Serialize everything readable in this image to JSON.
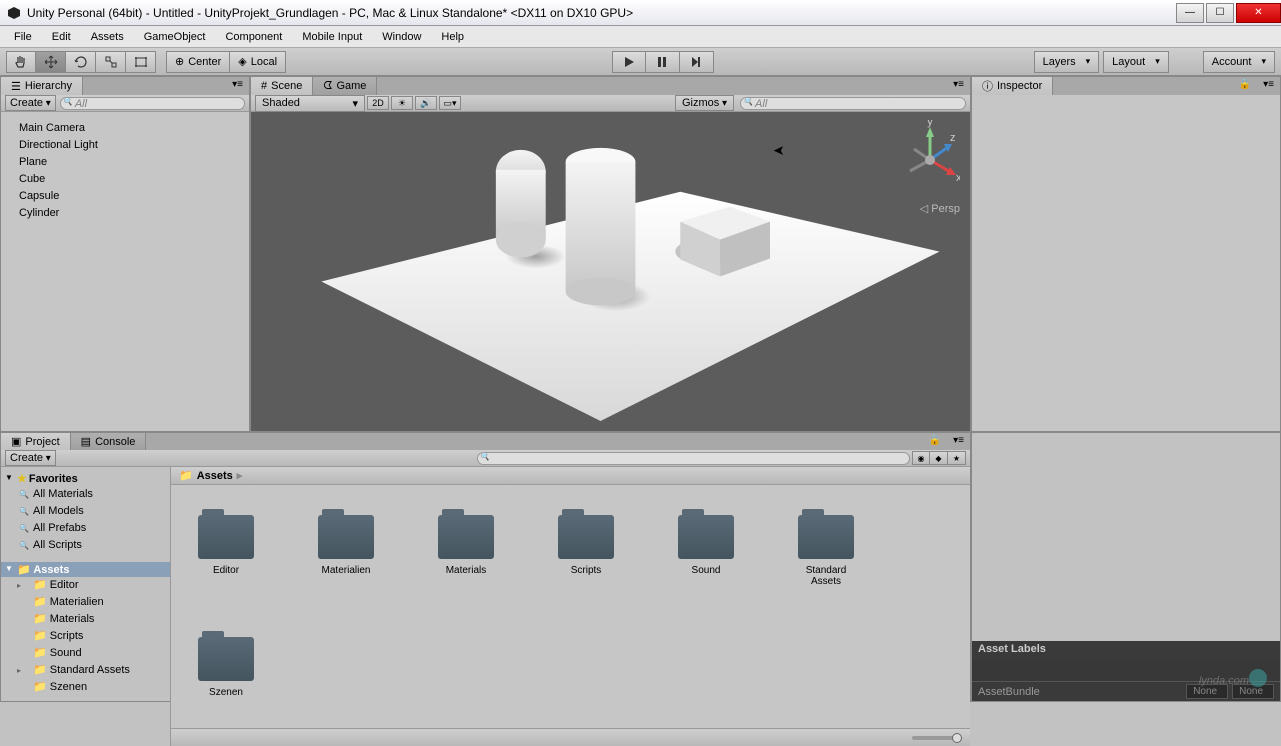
{
  "title": "Unity Personal (64bit) - Untitled - UnityProjekt_Grundlagen - PC, Mac & Linux Standalone* <DX11 on DX10 GPU>",
  "menu": [
    "File",
    "Edit",
    "Assets",
    "GameObject",
    "Component",
    "Mobile Input",
    "Window",
    "Help"
  ],
  "toolbar": {
    "center": "Center",
    "local": "Local",
    "layers": "Layers",
    "layout": "Layout",
    "account": "Account"
  },
  "hierarchy": {
    "tab": "Hierarchy",
    "create": "Create",
    "searchPlaceholder": "All",
    "items": [
      "Main Camera",
      "Directional Light",
      "Plane",
      "Cube",
      "Capsule",
      "Cylinder"
    ]
  },
  "scene": {
    "tabScene": "Scene",
    "tabGame": "Game",
    "shaded": "Shaded",
    "mode2d": "2D",
    "gizmos": "Gizmos",
    "searchPlaceholder": "All",
    "persp": "Persp"
  },
  "inspector": {
    "tab": "Inspector"
  },
  "project": {
    "tabProject": "Project",
    "tabConsole": "Console",
    "create": "Create",
    "favorites": "Favorites",
    "favItems": [
      "All Materials",
      "All Models",
      "All Prefabs",
      "All Scripts"
    ],
    "assetsRoot": "Assets",
    "treeFolders": [
      "Editor",
      "Materialien",
      "Materials",
      "Scripts",
      "Sound",
      "Standard Assets",
      "Szenen"
    ],
    "breadcrumb": "Assets",
    "gridFolders": [
      "Editor",
      "Materialien",
      "Materials",
      "Scripts",
      "Sound",
      "Standard Assets",
      "Szenen"
    ]
  },
  "assetLabels": "Asset Labels",
  "assetBundle": {
    "label": "AssetBundle",
    "val1": "None",
    "val2": "None"
  },
  "watermark": "lynda.com"
}
